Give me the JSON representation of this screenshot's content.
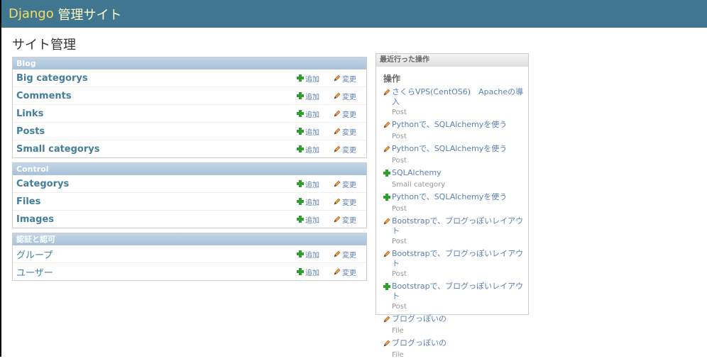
{
  "header": {
    "brand": "Django",
    "title": "管理サイト"
  },
  "page_title": "サイト管理",
  "add_label": "追加",
  "change_label": "変更",
  "modules": [
    {
      "caption": "Blog",
      "models": [
        "Big categorys",
        "Comments",
        "Links",
        "Posts",
        "Small categorys"
      ]
    },
    {
      "caption": "Control",
      "models": [
        "Categorys",
        "Files",
        "Images"
      ]
    },
    {
      "caption": "認証と認可",
      "models": [
        "グループ",
        "ユーザー"
      ]
    }
  ],
  "recent": {
    "caption": "最近行った操作",
    "heading": "操作",
    "items": [
      {
        "icon": "pencil-icon",
        "title": "さくらVPS(CentOS6)　Apacheの導入",
        "type": "Post"
      },
      {
        "icon": "pencil-icon",
        "title": "Pythonで、SQLAlchemyを使う",
        "type": "Post"
      },
      {
        "icon": "pencil-icon",
        "title": "Pythonで、SQLAlchemyを使う",
        "type": "Post"
      },
      {
        "icon": "plus-icon",
        "title": "SQLAlchemy",
        "type": "Small category"
      },
      {
        "icon": "plus-icon",
        "title": "Pythonで、SQLAlchemyを使う",
        "type": "Post"
      },
      {
        "icon": "pencil-icon",
        "title": "Bootstrapで、ブログっぽいレイアウト",
        "type": "Post"
      },
      {
        "icon": "pencil-icon",
        "title": "Bootstrapで、ブログっぽいレイアウト",
        "type": "Post"
      },
      {
        "icon": "plus-icon",
        "title": "Bootstrapで、ブログっぽいレイアウト",
        "type": "Post"
      },
      {
        "icon": "pencil-icon",
        "title": "ブログっぽいの",
        "type": "File"
      },
      {
        "icon": "pencil-icon",
        "title": "ブログっぽいの",
        "type": "File"
      }
    ]
  }
}
